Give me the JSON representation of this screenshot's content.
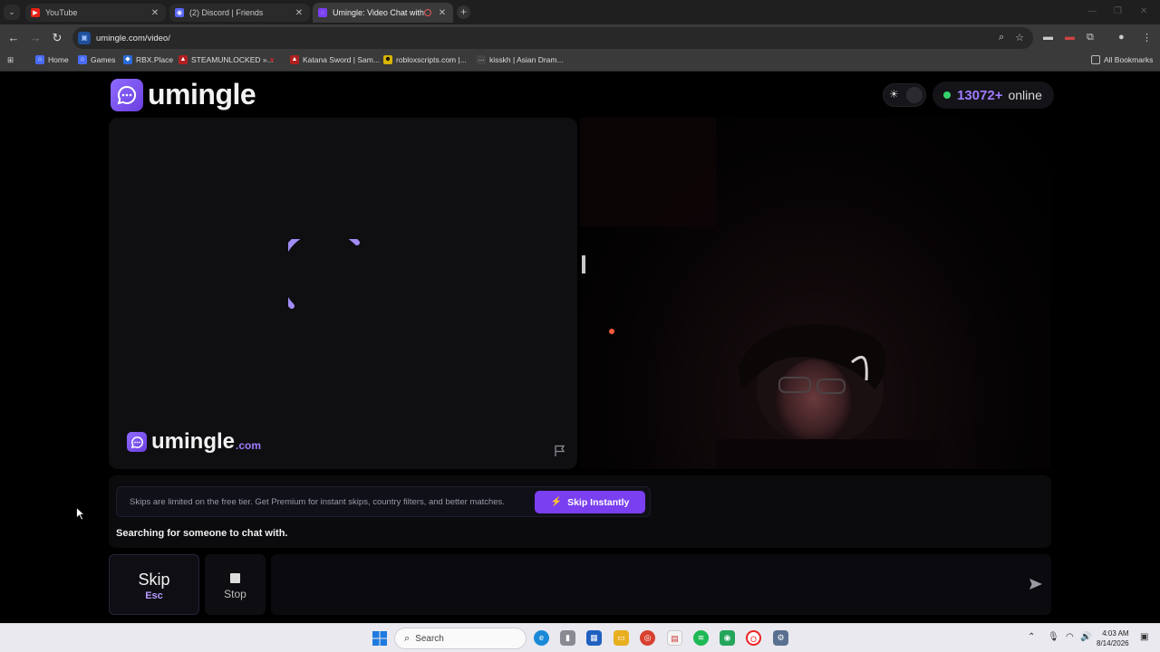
{
  "browser": {
    "tabs": [
      {
        "title": "YouTube",
        "active": false
      },
      {
        "title": "(2) Discord | Friends",
        "active": false
      },
      {
        "title": "Umingle: Video Chat with S",
        "active": true
      }
    ],
    "url": "umingle.com/video/",
    "bookmarks": [
      {
        "label": "Home"
      },
      {
        "label": "Games"
      },
      {
        "label": "RBX.Place"
      },
      {
        "label": "STEAMUNLOCKED »..."
      },
      {
        "label": "Katana Sword | Sam..."
      },
      {
        "label": "robloxscripts.com |..."
      },
      {
        "label": "kisskh | Asian Dram..."
      }
    ],
    "all_bookmarks": "All Bookmarks"
  },
  "site": {
    "logo_text": "umingle",
    "online_count": "13072+",
    "online_label": "online",
    "watermark_text": "umingle",
    "watermark_domain": ".com"
  },
  "notice": {
    "text": "Skips are limited on the free tier. Get Premium for instant skips, country filters, and better matches.",
    "button": "Skip Instantly"
  },
  "status": "Searching for someone to chat with.",
  "controls": {
    "skip_label": "Skip",
    "skip_key": "Esc",
    "stop_label": "Stop",
    "chat_placeholder": ""
  },
  "taskbar": {
    "search_label": "Search",
    "time": "4:03 AM",
    "date": "8/14/2026"
  },
  "colors": {
    "brand": "#7a3ff0",
    "online_dot": "#35d36a",
    "accent_text": "#a07bff"
  }
}
